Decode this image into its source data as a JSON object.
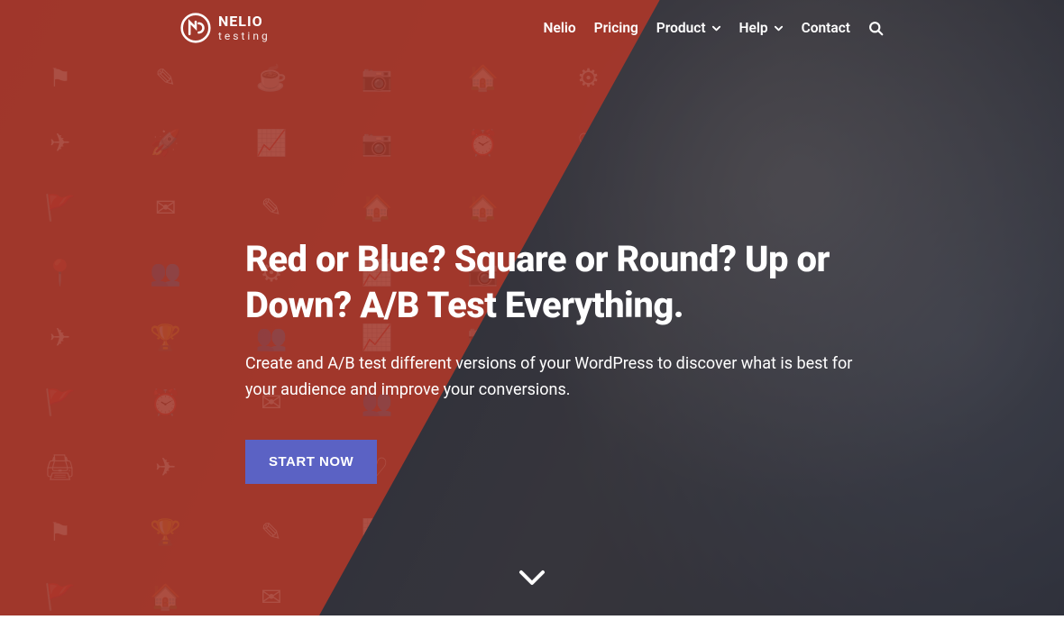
{
  "brand": {
    "name_line1": "NELIO",
    "name_line2": "testing"
  },
  "nav": {
    "items": [
      {
        "label": "Nelio",
        "dropdown": false
      },
      {
        "label": "Pricing",
        "dropdown": false
      },
      {
        "label": "Product",
        "dropdown": true
      },
      {
        "label": "Help",
        "dropdown": true
      },
      {
        "label": "Contact",
        "dropdown": false
      }
    ]
  },
  "hero": {
    "headline": "Red or Blue? Square or Round? Up or Down? A/B Test Everything.",
    "subhead": "Create and A/B test different versions of your WordPress to discover what is best for your audience and improve your conversions.",
    "cta_label": "START NOW"
  },
  "colors": {
    "overlay_red": "#a8372b",
    "cta": "#5b62c4"
  }
}
